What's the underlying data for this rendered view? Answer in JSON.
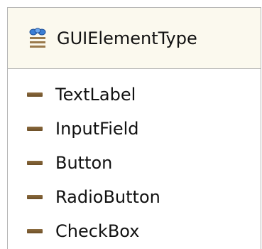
{
  "enumeration": {
    "name": "GUIElementType",
    "icon": "enumeration-icon",
    "literal_icon": "literal-dash-icon",
    "literals": [
      {
        "label": "TextLabel"
      },
      {
        "label": "InputField"
      },
      {
        "label": "Button"
      },
      {
        "label": "RadioButton"
      },
      {
        "label": "CheckBox"
      }
    ]
  },
  "colors": {
    "header_background": "#fbf9ee",
    "border": "#b5b5b5",
    "literal_icon": "#7a5a30"
  }
}
